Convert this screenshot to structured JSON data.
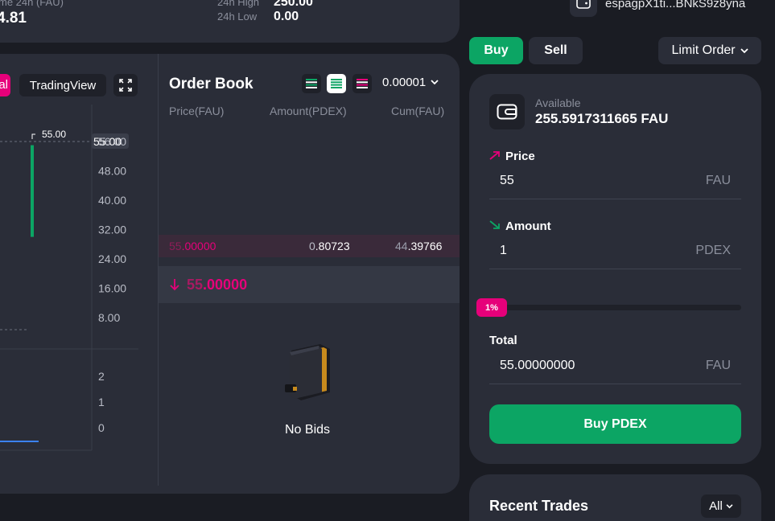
{
  "stats": {
    "volume_label": "me 24h (FAU)",
    "volume_value": "4.81",
    "high_label": "24h High",
    "high_value": "250.00",
    "low_label": "24h Low",
    "low_value": "0.00"
  },
  "wallet": {
    "address": "espagpX1ti...BNkS9z8yna"
  },
  "chart_toolbar": {
    "original_tab": "al",
    "tradingview_tab": "TradingView"
  },
  "chart_data": {
    "type": "candlestick",
    "last_price_marker": "55.00",
    "price_tag": "55.00",
    "price_axis_ticks": [
      "56.00",
      "48.00",
      "40.00",
      "32.00",
      "24.00",
      "16.00",
      "8.00"
    ],
    "volume_axis_ticks": [
      "2",
      "1",
      "0"
    ],
    "candles": [
      {
        "high": 55.0,
        "low": 30.0
      }
    ]
  },
  "orderbook": {
    "title": "Order Book",
    "precision": "0.00001",
    "headers": [
      "Price(FAU)",
      "Amount(PDEX)",
      "Cum(FAU)"
    ],
    "asks": [
      {
        "price_dim": "55",
        "price_bright": ".00000",
        "amount_dim": "0",
        "amount_bright": ".80723",
        "cum_dim": "44",
        "cum_bright": ".39766"
      }
    ],
    "last_price_dim": "55",
    "last_price_bright": ".00000",
    "no_bids": "No Bids"
  },
  "trade_form": {
    "buy_tab": "Buy",
    "sell_tab": "Sell",
    "order_type": "Limit Order",
    "available_label": "Available",
    "available_value": "255.5917311665 FAU",
    "price_label": "Price",
    "price_value": "55",
    "price_unit": "FAU",
    "amount_label": "Amount",
    "amount_value": "1",
    "amount_unit": "PDEX",
    "slider_pct": "1%",
    "slider_fraction": 0.01,
    "total_label": "Total",
    "total_value": "55.00000000",
    "total_unit": "FAU",
    "submit": "Buy PDEX"
  },
  "recent_trades": {
    "title": "Recent Trades",
    "filter": "All"
  },
  "colors": {
    "buy": "#0ca564",
    "sell": "#e6007a",
    "panel": "#2a2d38",
    "bg": "#1a1c23"
  }
}
